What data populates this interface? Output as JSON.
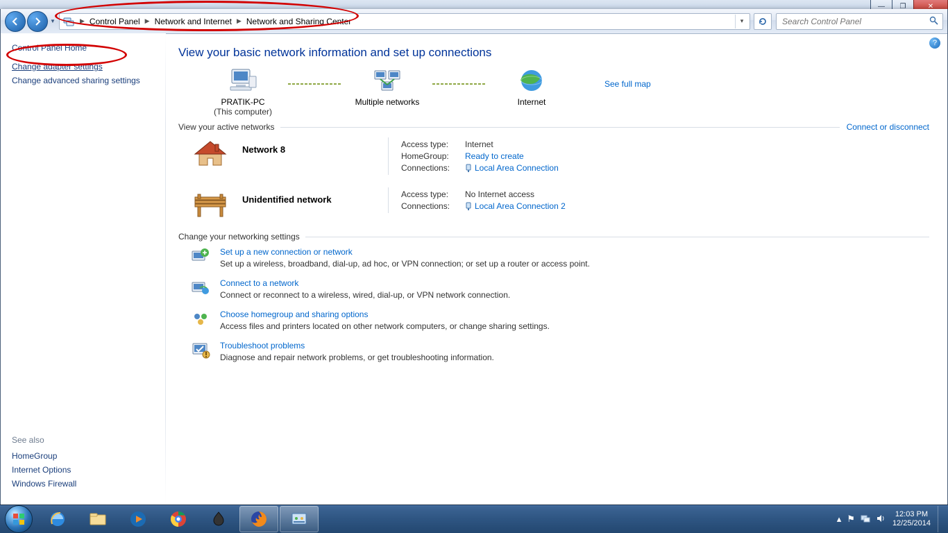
{
  "chrome": {
    "min": "—",
    "max": "❐",
    "close": "✕"
  },
  "breadcrumb": {
    "root": "Control Panel",
    "mid": "Network and Internet",
    "leaf": "Network and Sharing Center"
  },
  "search_placeholder": "Search Control Panel",
  "sidebar": {
    "home": "Control Panel Home",
    "adapter": "Change adapter settings",
    "advanced": "Change advanced sharing settings",
    "see_also": "See also",
    "links": [
      "HomeGroup",
      "Internet Options",
      "Windows Firewall"
    ]
  },
  "main": {
    "title": "View your basic network information and set up connections",
    "see_full_map": "See full map",
    "map": {
      "pc": "PRATIK-PC",
      "pc_sub": "(This computer)",
      "mid": "Multiple networks",
      "net": "Internet"
    },
    "active_head": "View your active networks",
    "connect_link": "Connect or disconnect",
    "net1": {
      "name": "Network  8",
      "access_k": "Access type:",
      "access_v": "Internet",
      "hg_k": "HomeGroup:",
      "hg_v": "Ready to create",
      "conn_k": "Connections:",
      "conn_v": "Local Area Connection"
    },
    "net2": {
      "name": "Unidentified network",
      "access_k": "Access type:",
      "access_v": "No Internet access",
      "conn_k": "Connections:",
      "conn_v": "Local Area Connection 2"
    },
    "change_head": "Change your networking settings",
    "tasks": [
      {
        "t": "Set up a new connection or network",
        "d": "Set up a wireless, broadband, dial-up, ad hoc, or VPN connection; or set up a router or access point."
      },
      {
        "t": "Connect to a network",
        "d": "Connect or reconnect to a wireless, wired, dial-up, or VPN network connection."
      },
      {
        "t": "Choose homegroup and sharing options",
        "d": "Access files and printers located on other network computers, or change sharing settings."
      },
      {
        "t": "Troubleshoot problems",
        "d": "Diagnose and repair network problems, or get troubleshooting information."
      }
    ]
  },
  "tray": {
    "time": "12:03 PM",
    "date": "12/25/2014"
  }
}
